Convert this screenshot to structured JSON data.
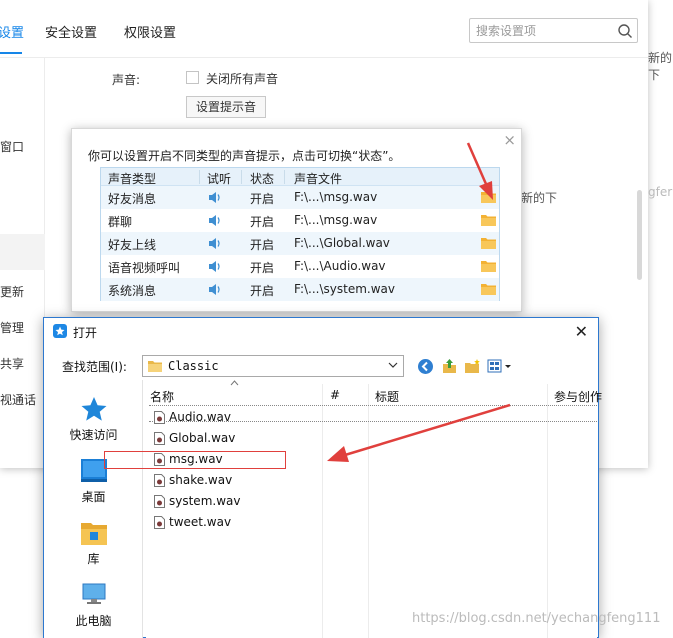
{
  "settings": {
    "tabs": [
      "设置",
      "安全设置",
      "权限设置"
    ],
    "search_placeholder": "搜索设置项",
    "nav": [
      "窗口",
      "更新",
      "管理",
      "共享",
      "视通话"
    ],
    "sound_label": "声音:",
    "mute_all_label": "关闭所有声音",
    "sound_prompt_button": "设置提示音",
    "right_partial_1": "新的下",
    "right_partial_2": "最新的下",
    "right_partial_3": "gfer"
  },
  "sound_dialog": {
    "close": "×",
    "hint": "你可以设置开启不同类型的声音提示，点击可切换“状态”。",
    "columns": [
      "声音类型",
      "试听",
      "状态",
      "声音文件"
    ],
    "rows": [
      {
        "type": "好友消息",
        "status": "开启",
        "file": "F:\\...\\msg.wav"
      },
      {
        "type": "群聊",
        "status": "开启",
        "file": "F:\\...\\msg.wav"
      },
      {
        "type": "好友上线",
        "status": "开启",
        "file": "F:\\...\\Global.wav"
      },
      {
        "type": "语音视频呼叫",
        "status": "开启",
        "file": "F:\\...\\Audio.wav"
      },
      {
        "type": "系统消息",
        "status": "开启",
        "file": "F:\\...\\system.wav"
      }
    ]
  },
  "open_dialog": {
    "title": "打开",
    "close": "✕",
    "lookin_label": "查找范围(I):",
    "lookin_value": "Classic",
    "places": [
      "快速访问",
      "桌面",
      "库",
      "此电脑"
    ],
    "columns": [
      "名称",
      "#",
      "标题",
      "参与创作"
    ],
    "files": [
      "Audio.wav",
      "Global.wav",
      "msg.wav",
      "shake.wav",
      "system.wav",
      "tweet.wav"
    ]
  },
  "watermark": "https://blog.csdn.net/yechangfeng111",
  "colors": {
    "accent": "#1686e8",
    "annotation_red": "#e0403d",
    "dialog_border": "#2d78cf",
    "table_header": "#e6f1fa"
  }
}
